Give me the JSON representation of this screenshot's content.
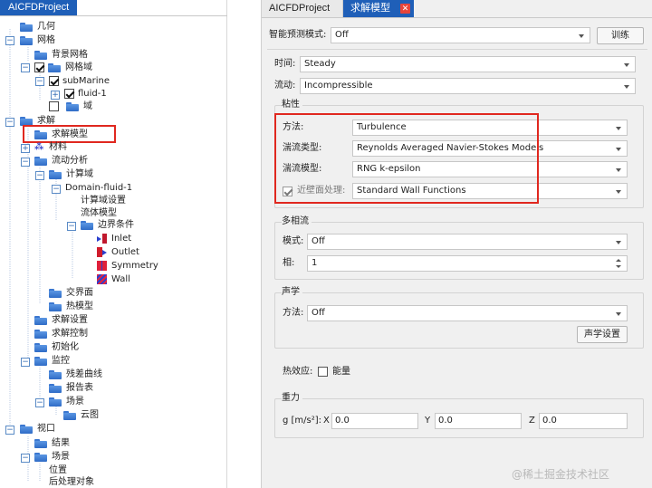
{
  "left_panel": {
    "tab_title": "AICFDProject",
    "tree": {
      "geometry": "几何",
      "mesh": "网格",
      "background_mesh": "背景网格",
      "mesh_domain": "网格域",
      "submarine": "subMarine",
      "fluid": "fluid-1",
      "domain": "域",
      "solve": "求解",
      "solver_model": "求解模型",
      "material": "材料",
      "flow_analysis": "流动分析",
      "compute_domain": "计算域",
      "domain_fluid": "Domain-fluid-1",
      "compute_domain_settings": "计算域设置",
      "fluid_model": "流体模型",
      "boundary_conditions": "边界条件",
      "inlet": "Inlet",
      "outlet": "Outlet",
      "symmetry": "Symmetry",
      "wall": "Wall",
      "interface": "交界面",
      "thermal_model": "热模型",
      "solve_settings": "求解设置",
      "solve_control": "求解控制",
      "initialization": "初始化",
      "monitor": "监控",
      "residual_curve": "残差曲线",
      "report_table": "报告表",
      "scene": "场景",
      "contour": "云图",
      "viewport": "视口",
      "result": "结果",
      "viewport_scene": "场景",
      "position": "位置",
      "post_object": "后处理对象"
    }
  },
  "right_panel": {
    "tabs": [
      "AICFDProject",
      "求解模型"
    ],
    "smart_prediction": {
      "label": "智能预测模式:",
      "value": "Off",
      "train_button": "训练"
    },
    "time": {
      "label": "时间:",
      "value": "Steady"
    },
    "flow": {
      "label": "流动:",
      "value": "Incompressible"
    },
    "viscosity": {
      "title": "粘性",
      "method_label": "方法:",
      "method_value": "Turbulence",
      "turb_type_label": "湍流类型:",
      "turb_type_value": "Reynolds Averaged Navier-Stokes Models",
      "turb_model_label": "湍流模型:",
      "turb_model_value": "RNG k-epsilon",
      "near_wall_label": "近壁面处理:",
      "near_wall_value": "Standard Wall Functions",
      "near_wall_checked": true
    },
    "multiphase": {
      "title": "多相流",
      "mode_label": "模式:",
      "mode_value": "Off",
      "phase_label": "相:",
      "phase_value": "1"
    },
    "acoustics": {
      "title": "声学",
      "method_label": "方法:",
      "method_value": "Off",
      "settings_button": "声学设置"
    },
    "thermal": {
      "label": "热效应:",
      "energy_label": "能量",
      "energy_checked": false
    },
    "gravity": {
      "title": "重力",
      "g_label": "g [m/s²]:",
      "x_label": "X",
      "x_value": "0.0",
      "y_label": "Y",
      "y_value": "0.0",
      "z_label": "Z",
      "z_value": "0.0"
    }
  },
  "watermark": "@稀土掘金技术社区"
}
